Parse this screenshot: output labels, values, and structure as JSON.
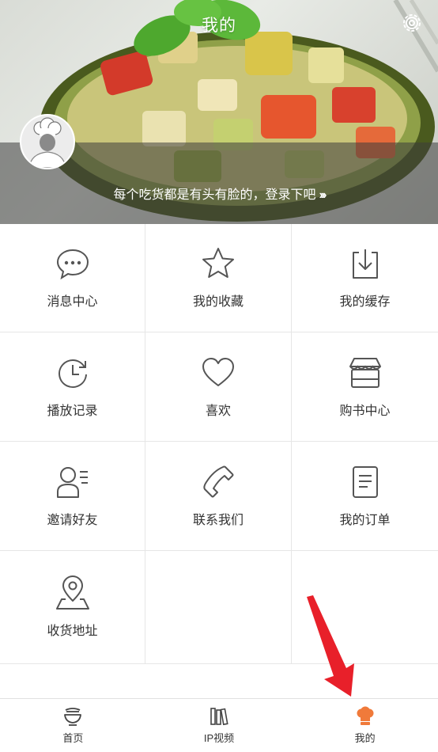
{
  "header": {
    "title": "我的",
    "login_prompt": "每个吃货都是有头有脸的，登录下吧",
    "login_arrows": "›››"
  },
  "grid": [
    {
      "label": "消息中心",
      "icon": "chat-bubble-icon"
    },
    {
      "label": "我的收藏",
      "icon": "star-icon"
    },
    {
      "label": "我的缓存",
      "icon": "download-icon"
    },
    {
      "label": "播放记录",
      "icon": "history-clock-icon"
    },
    {
      "label": "喜欢",
      "icon": "heart-icon"
    },
    {
      "label": "购书中心",
      "icon": "store-icon"
    },
    {
      "label": "邀请好友",
      "icon": "invite-user-icon"
    },
    {
      "label": "联系我们",
      "icon": "phone-icon"
    },
    {
      "label": "我的订单",
      "icon": "order-list-icon"
    },
    {
      "label": "收货地址",
      "icon": "location-pin-icon"
    }
  ],
  "tabbar": {
    "items": [
      {
        "label": "首页",
        "icon": "bowl-icon"
      },
      {
        "label": "IP视频",
        "icon": "books-icon"
      },
      {
        "label": "我的",
        "icon": "chef-hat-icon",
        "active": true
      }
    ]
  },
  "colors": {
    "accent": "#f07a3a",
    "icon_gray": "#555555",
    "divider": "#e6e6e6",
    "annotation_arrow": "#e8202a"
  }
}
